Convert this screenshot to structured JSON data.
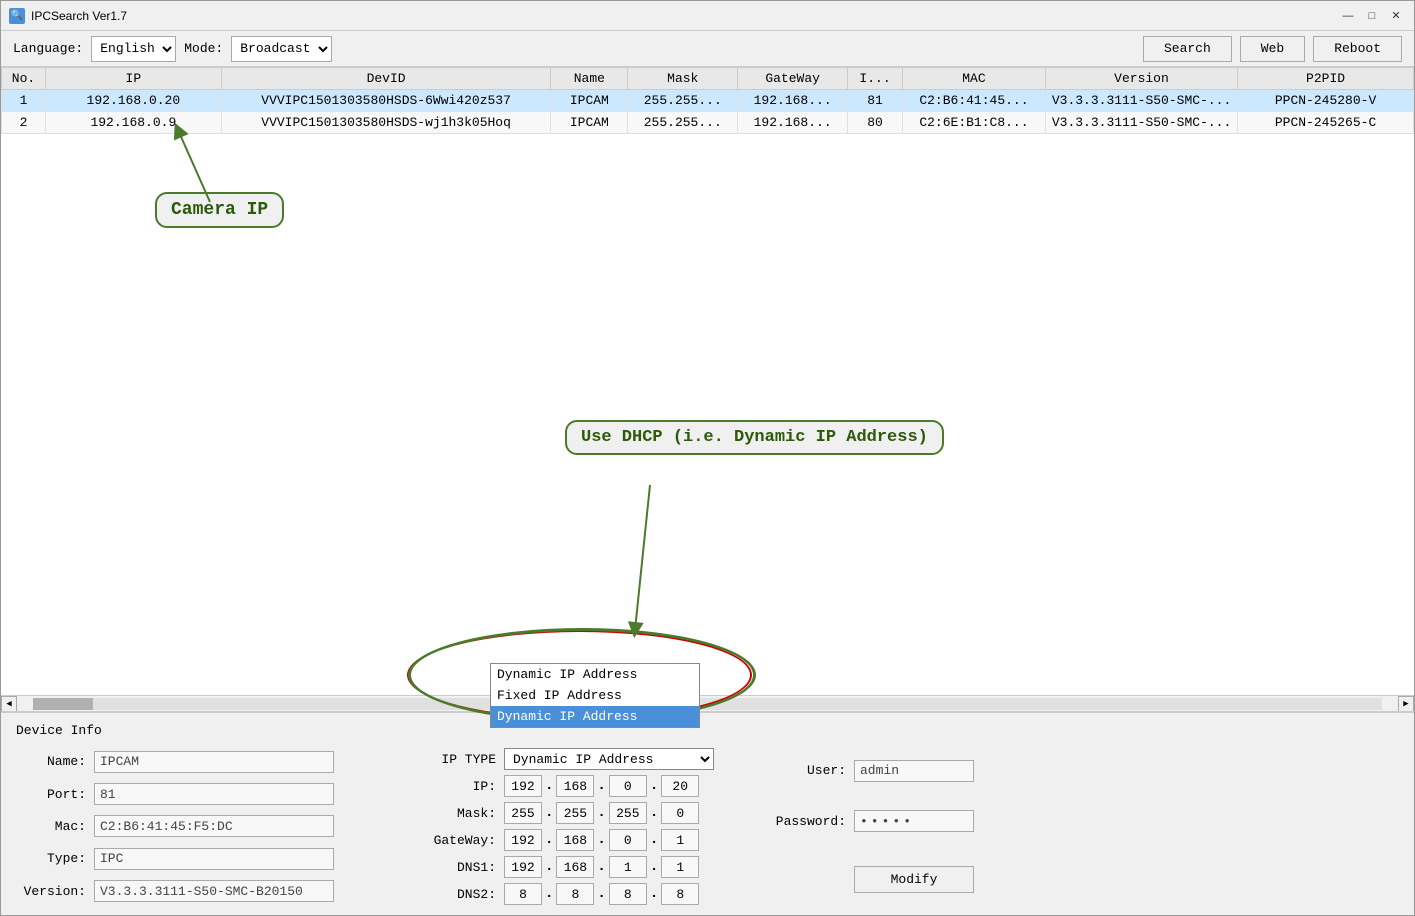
{
  "window": {
    "title": "IPCSearch Ver1.7",
    "icon": "🔍"
  },
  "toolbar": {
    "language_label": "Language:",
    "language_options": [
      "English"
    ],
    "language_selected": "English",
    "mode_label": "Mode:",
    "mode_options": [
      "Broadcast"
    ],
    "mode_selected": "Broadcast",
    "search_btn": "Search",
    "web_btn": "Web",
    "reboot_btn": "Reboot"
  },
  "table": {
    "columns": [
      "No.",
      "IP",
      "DevID",
      "Name",
      "Mask",
      "GateWay",
      "I...",
      "MAC",
      "Version",
      "P2PID"
    ],
    "rows": [
      {
        "no": "1",
        "ip": "192.168.0.20",
        "devid": "VVVIPC1501303580HSDS-6Wwi420z537",
        "name": "IPCAM",
        "mask": "255.255...",
        "gateway": "192.168...",
        "i": "81",
        "mac": "C2:B6:41:45...",
        "version": "V3.3.3.3111-S50-SMC-...",
        "p2pid": "PPCN-245280-V",
        "selected": true
      },
      {
        "no": "2",
        "ip": "192.168.0.9",
        "devid": "VVVIPC1501303580HSDS-wj1h3k05Hoq",
        "name": "IPCAM",
        "mask": "255.255...",
        "gateway": "192.168...",
        "i": "80",
        "mac": "C2:6E:B1:C8...",
        "version": "V3.3.3.3111-S50-SMC-...",
        "p2pid": "PPCN-245265-C",
        "selected": false
      }
    ]
  },
  "annotations": {
    "camera_ip": "Camera IP",
    "dhcp": "Use DHCP (i.e. Dynamic IP Address)"
  },
  "device_info": {
    "title": "Device Info",
    "name_label": "Name:",
    "name_value": "IPCAM",
    "port_label": "Port:",
    "port_value": "81",
    "mac_label": "Mac:",
    "mac_value": "C2:B6:41:45:F5:DC",
    "type_label": "Type:",
    "type_value": "IPC",
    "version_label": "Version:",
    "version_value": "V3.3.3.3111-S50-SMC-B20150",
    "ip_type_label": "IP TYPE",
    "ip_type_selected": "Dynamic IP Address",
    "ip_type_options": [
      "Dynamic IP Address",
      "Fixed IP Address",
      "Dynamic IP Address"
    ],
    "ip_label": "IP:",
    "ip_value": [
      "192",
      "168",
      "0",
      "20"
    ],
    "mask_label": "Mask:",
    "mask_value": [
      "255",
      "255",
      "255",
      "0"
    ],
    "gateway_label": "GateWay:",
    "gateway_value": [
      "192",
      "168",
      "0",
      "1"
    ],
    "dns1_label": "DNS1:",
    "dns1_value": [
      "192",
      "168",
      "1",
      "1"
    ],
    "dns2_label": "DNS2:",
    "dns2_value": [
      "8",
      "8",
      "8",
      "8"
    ],
    "user_label": "User:",
    "user_value": "admin",
    "password_label": "Password:",
    "password_value": "●●●●●",
    "modify_btn": "Modify"
  },
  "dropdown": {
    "option1": "Dynamic IP Address",
    "option2": "Fixed IP Address",
    "option3": "Dynamic IP Address"
  },
  "colors": {
    "selected_row_bg": "#cce8ff",
    "dropdown_selected_bg": "#4a90d9",
    "annotation_green": "#2d5a0a",
    "annotation_red": "#cc0000"
  }
}
